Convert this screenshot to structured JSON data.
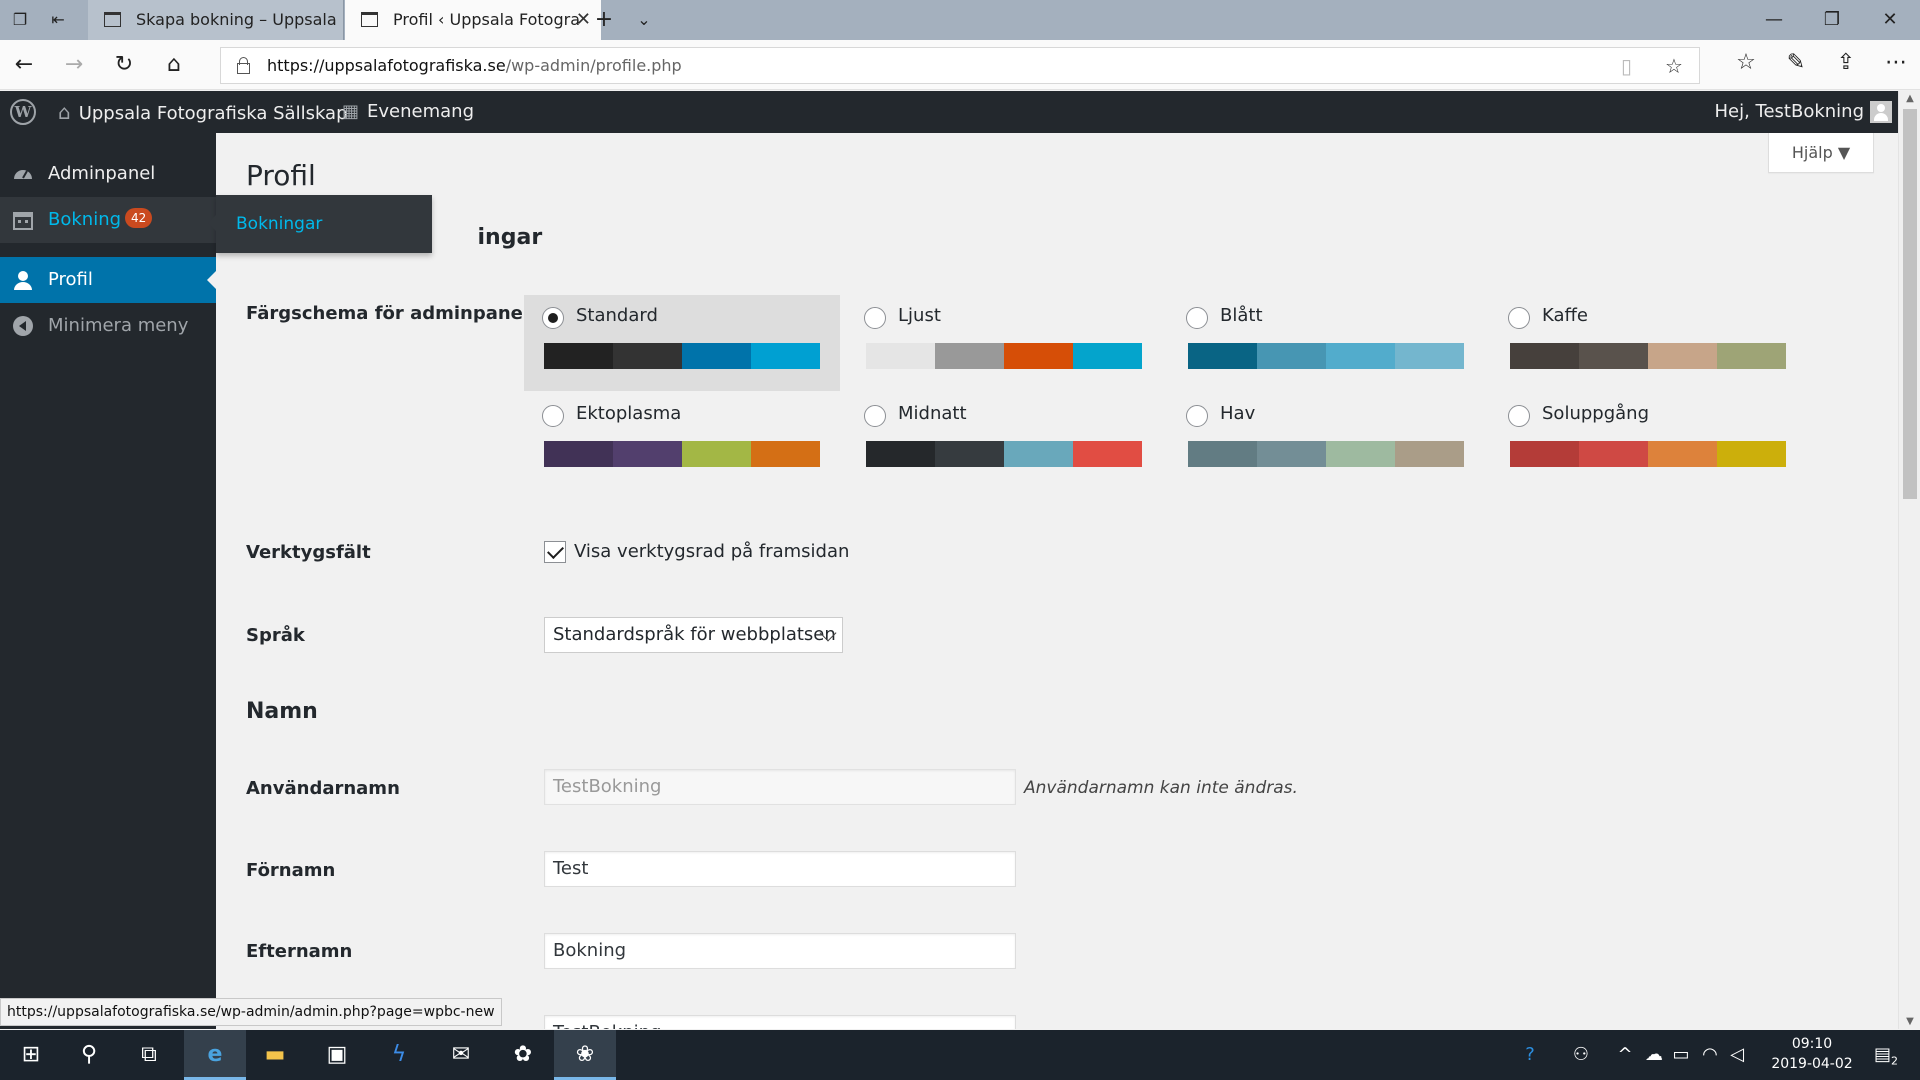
{
  "browser": {
    "tabs": [
      {
        "title": "Skapa bokning – Uppsala Fo"
      },
      {
        "title": "Profil ‹ Uppsala Fotogra"
      }
    ],
    "url_host": "https://uppsalafotografiska.se",
    "url_path": "/wp-admin/profile.php",
    "status_url": "https://uppsalafotografiska.se/wp-admin/admin.php?page=wpbc-new"
  },
  "adminbar": {
    "site_name": "Uppsala Fotografiska Sällskap",
    "events": "Evenemang",
    "greeting": "Hej, TestBokning"
  },
  "menu": {
    "dashboard": "Adminpanel",
    "booking": "Bokning",
    "booking_count": "42",
    "booking_sub": "Bokningar",
    "profile": "Profil",
    "collapse": "Minimera meny"
  },
  "page": {
    "title": "Profil",
    "section_personal_tail": "ingar",
    "help": "Hjälp ▼",
    "color_scheme_label": "Färgschema för adminpanel",
    "schemes": [
      {
        "name": "Standard",
        "colors": [
          "#222222",
          "#333333",
          "#0073aa",
          "#00a0d2"
        ],
        "checked": true
      },
      {
        "name": "Ljust",
        "colors": [
          "#e5e5e5",
          "#999999",
          "#d64e07",
          "#04a4cc"
        ],
        "checked": false
      },
      {
        "name": "Blått",
        "colors": [
          "#096484",
          "#4796b3",
          "#52accc",
          "#74b6ce"
        ],
        "checked": false
      },
      {
        "name": "Kaffe",
        "colors": [
          "#46403c",
          "#59524c",
          "#c7a589",
          "#9ea476"
        ],
        "checked": false
      },
      {
        "name": "Ektoplasma",
        "colors": [
          "#413256",
          "#523f6d",
          "#a3b745",
          "#d46f15"
        ],
        "checked": false
      },
      {
        "name": "Midnatt",
        "colors": [
          "#25282b",
          "#363b3f",
          "#69a8bb",
          "#e14d43"
        ],
        "checked": false
      },
      {
        "name": "Hav",
        "colors": [
          "#627c83",
          "#738e96",
          "#9ebaa0",
          "#aa9d88"
        ],
        "checked": false
      },
      {
        "name": "Soluppgång",
        "colors": [
          "#b43c38",
          "#cf4944",
          "#dd823b",
          "#ccaf0b"
        ],
        "checked": false
      }
    ],
    "toolbar_label": "Verktygsfält",
    "toolbar_checkbox": "Visa verktygsrad på framsidan",
    "language_label": "Språk",
    "language_value": "Standardspråk för webbplatsen",
    "section_name": "Namn",
    "username_label": "Användarnamn",
    "username_value": "TestBokning",
    "username_desc": "Användarnamn kan inte ändras.",
    "firstname_label": "Förnamn",
    "firstname_value": "Test",
    "lastname_label": "Efternamn",
    "lastname_value": "Bokning",
    "nickname_value": "TestBokning"
  },
  "taskbar": {
    "time": "09:10",
    "date": "2019-04-02",
    "notifications": "2"
  }
}
